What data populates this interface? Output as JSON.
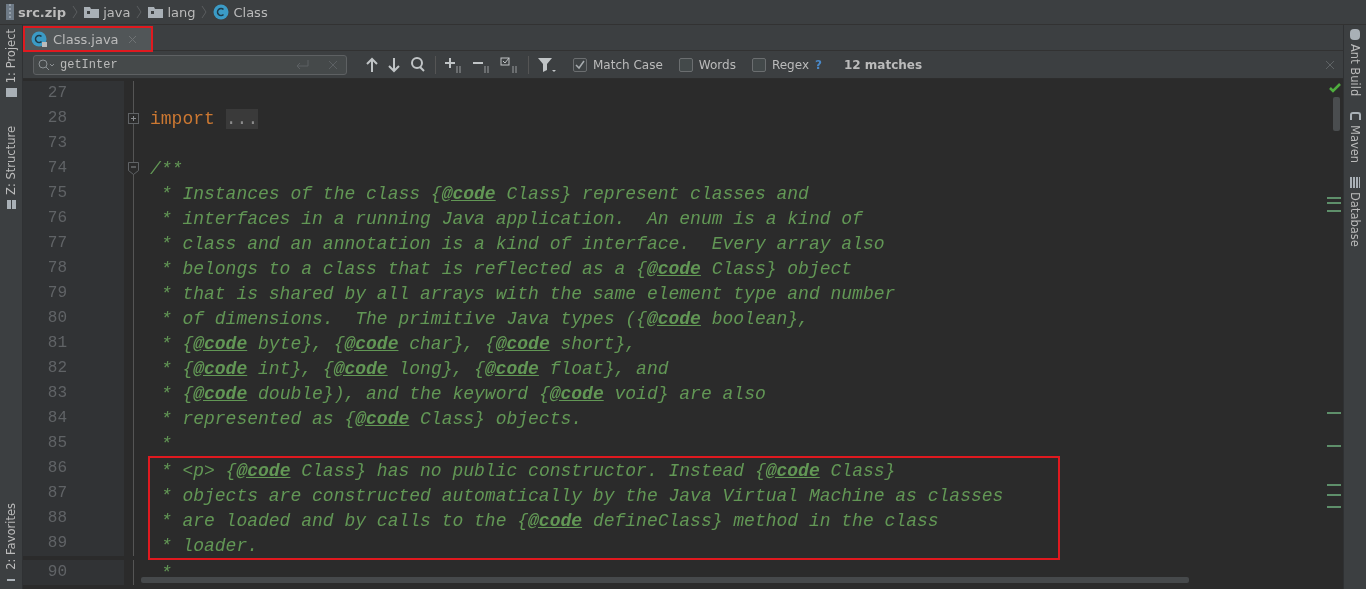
{
  "breadcrumb": [
    {
      "label": "src.zip",
      "kind": "archive"
    },
    {
      "label": "java",
      "kind": "folder"
    },
    {
      "label": "lang",
      "kind": "folder"
    },
    {
      "label": "Class",
      "kind": "class"
    }
  ],
  "tabs": [
    {
      "label": "Class.java",
      "selected": true,
      "outlined": true
    }
  ],
  "left_tools": [
    {
      "label": "1: Project",
      "kind": "folder"
    },
    {
      "label": "Z: Structure",
      "kind": "structure"
    },
    {
      "label": "2: Favorites",
      "kind": "star"
    }
  ],
  "right_tools": [
    {
      "label": "Ant Build",
      "kind": "ant"
    },
    {
      "label": "Maven",
      "kind": "maven"
    },
    {
      "label": "Database",
      "kind": "database"
    }
  ],
  "find": {
    "value": "getInter",
    "options": [
      {
        "label": "Match Case",
        "checked": true
      },
      {
        "label": "Words",
        "checked": false
      },
      {
        "label": "Regex",
        "checked": false
      }
    ],
    "help": "?",
    "matches": "12 matches"
  },
  "lines": [
    {
      "number": "27",
      "boxed": false
    },
    {
      "number": "28",
      "boxed": false,
      "expanded": false,
      "segments": [
        {
          "kind": "keyword",
          "text": "import"
        },
        {
          "kind": "folded",
          "text": "..."
        }
      ]
    },
    {
      "number": "73",
      "boxed": false
    },
    {
      "number": "74",
      "boxed": false,
      "expanded": true,
      "segments": [
        {
          "kind": "comment",
          "text": "/**"
        }
      ]
    },
    {
      "number": "75",
      "boxed": false,
      "segments": [
        {
          "kind": "comment",
          "text": " * Instances of the class {"
        },
        {
          "kind": "tag",
          "text": "@code"
        },
        {
          "kind": "comment",
          "text": " Class} represent classes and"
        }
      ]
    },
    {
      "number": "76",
      "boxed": false,
      "segments": [
        {
          "kind": "comment",
          "text": " * interfaces in a running Java application.  An enum is a kind of"
        }
      ]
    },
    {
      "number": "77",
      "boxed": false,
      "segments": [
        {
          "kind": "comment",
          "text": " * class and an annotation is a kind of interface.  Every array also"
        }
      ]
    },
    {
      "number": "78",
      "boxed": false,
      "segments": [
        {
          "kind": "comment",
          "text": " * belongs to a class that is reflected as a {"
        },
        {
          "kind": "tag",
          "text": "@code"
        },
        {
          "kind": "comment",
          "text": " Class} object"
        }
      ]
    },
    {
      "number": "79",
      "boxed": false,
      "segments": [
        {
          "kind": "comment",
          "text": " * that is shared by all arrays with the same element type and number"
        }
      ]
    },
    {
      "number": "80",
      "boxed": false,
      "segments": [
        {
          "kind": "comment",
          "text": " * of dimensions.  The primitive Java types ({"
        },
        {
          "kind": "tag",
          "text": "@code"
        },
        {
          "kind": "comment",
          "text": " boolean},"
        }
      ]
    },
    {
      "number": "81",
      "boxed": false,
      "segments": [
        {
          "kind": "comment",
          "text": " * {"
        },
        {
          "kind": "tag",
          "text": "@code"
        },
        {
          "kind": "comment",
          "text": " byte}, {"
        },
        {
          "kind": "tag",
          "text": "@code"
        },
        {
          "kind": "comment",
          "text": " char}, {"
        },
        {
          "kind": "tag",
          "text": "@code"
        },
        {
          "kind": "comment",
          "text": " short},"
        }
      ]
    },
    {
      "number": "82",
      "boxed": false,
      "segments": [
        {
          "kind": "comment",
          "text": " * {"
        },
        {
          "kind": "tag",
          "text": "@code"
        },
        {
          "kind": "comment",
          "text": " int}, {"
        },
        {
          "kind": "tag",
          "text": "@code"
        },
        {
          "kind": "comment",
          "text": " long}, {"
        },
        {
          "kind": "tag",
          "text": "@code"
        },
        {
          "kind": "comment",
          "text": " float}, and"
        }
      ]
    },
    {
      "number": "83",
      "boxed": false,
      "segments": [
        {
          "kind": "comment",
          "text": " * {"
        },
        {
          "kind": "tag",
          "text": "@code"
        },
        {
          "kind": "comment",
          "text": " double}), and the keyword {"
        },
        {
          "kind": "tag",
          "text": "@code"
        },
        {
          "kind": "comment",
          "text": " void} are also"
        }
      ]
    },
    {
      "number": "84",
      "boxed": false,
      "segments": [
        {
          "kind": "comment",
          "text": " * represented as {"
        },
        {
          "kind": "tag",
          "text": "@code"
        },
        {
          "kind": "comment",
          "text": " Class} objects."
        }
      ]
    },
    {
      "number": "85",
      "boxed": false,
      "segments": [
        {
          "kind": "comment",
          "text": " *"
        }
      ]
    },
    {
      "number": "86",
      "boxed": true,
      "segments": [
        {
          "kind": "comment",
          "text": " * <p> {"
        },
        {
          "kind": "tag",
          "text": "@code"
        },
        {
          "kind": "comment",
          "text": " Class} has no public constructor. Instead {"
        },
        {
          "kind": "tag",
          "text": "@code"
        },
        {
          "kind": "comment",
          "text": " Class}"
        }
      ]
    },
    {
      "number": "87",
      "boxed": true,
      "segments": [
        {
          "kind": "comment",
          "text": " * objects are constructed automatically by the Java Virtual Machine as classes"
        }
      ]
    },
    {
      "number": "88",
      "boxed": true,
      "segments": [
        {
          "kind": "comment",
          "text": " * are loaded and by calls to the {"
        },
        {
          "kind": "tag",
          "text": "@code"
        },
        {
          "kind": "comment",
          "text": " defineClass} method in the class"
        }
      ]
    },
    {
      "number": "89",
      "boxed": true,
      "segments": [
        {
          "kind": "comment",
          "text": " * loader."
        }
      ]
    },
    {
      "number": "90",
      "boxed": false,
      "segments": [
        {
          "kind": "comment",
          "text": " *"
        }
      ]
    }
  ]
}
